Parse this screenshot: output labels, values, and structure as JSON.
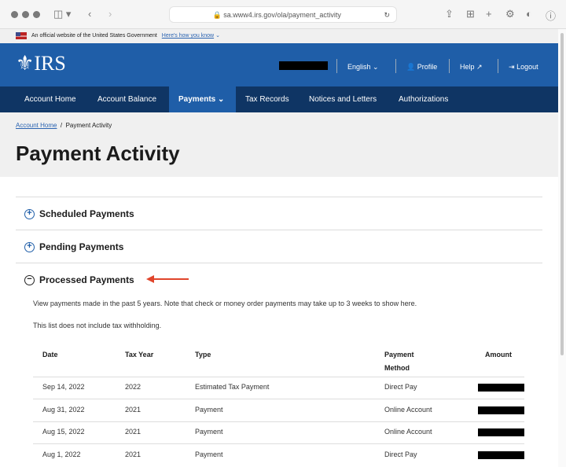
{
  "browser": {
    "url": "sa.www4.irs.gov/ola/payment_activity"
  },
  "banner": {
    "text": "An official website of the United States Government",
    "link": "Here's how you know"
  },
  "header": {
    "logo": "IRS",
    "language": "English",
    "profile": "Profile",
    "help": "Help",
    "logout": "Logout"
  },
  "nav": [
    "Account Home",
    "Account Balance",
    "Payments",
    "Tax Records",
    "Notices and Letters",
    "Authorizations"
  ],
  "breadcrumb": {
    "home": "Account Home",
    "current": "Payment Activity"
  },
  "page_title": "Payment Activity",
  "sections": {
    "scheduled": "Scheduled Payments",
    "pending": "Pending Payments",
    "processed": "Processed Payments"
  },
  "processed": {
    "note1": "View payments made in the past 5 years. Note that check or money order payments may take up to 3 weeks to show here.",
    "note2": "This list does not include tax withholding."
  },
  "table": {
    "headers": [
      "Date",
      "Tax Year",
      "Type",
      "Payment Method",
      "Amount"
    ],
    "rows": [
      {
        "date": "Sep 14, 2022",
        "year": "2022",
        "type": "Estimated Tax Payment",
        "method": "Direct Pay"
      },
      {
        "date": "Aug 31, 2022",
        "year": "2021",
        "type": "Payment",
        "method": "Online Account"
      },
      {
        "date": "Aug 15, 2022",
        "year": "2021",
        "type": "Payment",
        "method": "Online Account"
      },
      {
        "date": "Aug 1, 2022",
        "year": "2021",
        "type": "Payment",
        "method": "Direct Pay"
      }
    ]
  },
  "colors": {
    "header": "#1f5ea8",
    "nav": "#0f3564",
    "arrow": "#e0452b"
  }
}
